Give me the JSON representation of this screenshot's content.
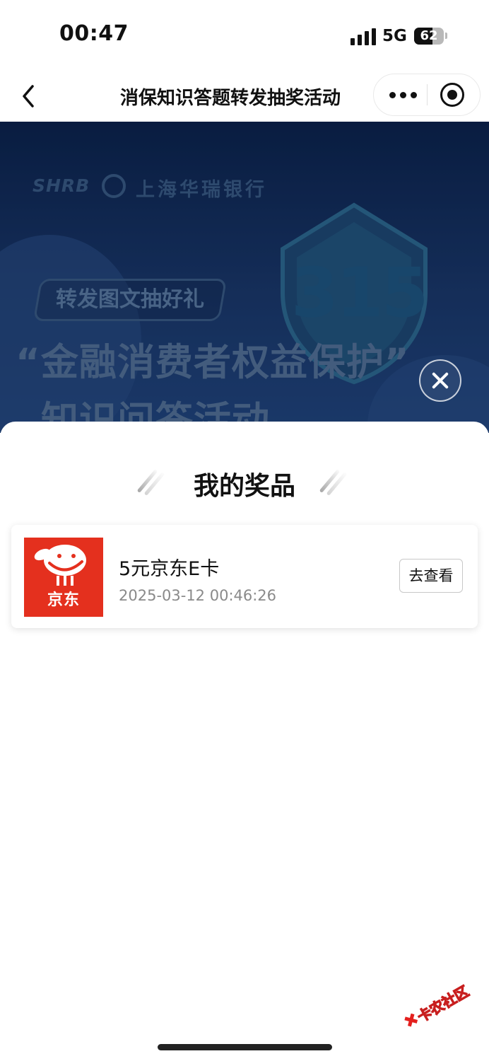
{
  "status_bar": {
    "time": "00:47",
    "network": "5G",
    "battery_level": 62
  },
  "nav": {
    "title": "消保知识答题转发抽奖活动",
    "icons": [
      "chevron-left-icon",
      "more-dots-icon",
      "target-icon"
    ]
  },
  "banner": {
    "logo_en": "SHRB",
    "logo_cn": "上海华瑞银行",
    "badge_number": "315",
    "tag": "转发图文抽好礼",
    "headline_1": "“金融消费者权益保护”",
    "headline_2": "知识问答活动"
  },
  "prize_sheet": {
    "title": "我的奖品",
    "items": [
      {
        "logo_text": "京东",
        "name": "5元京东E卡",
        "time": "2025-03-12 00:46:26",
        "action_label": "去查看"
      }
    ]
  },
  "watermark": "卡农社区",
  "colors": {
    "banner_bg": "#0c2553",
    "jd_red": "#e4301e",
    "text_gray": "#8a8a8a"
  }
}
